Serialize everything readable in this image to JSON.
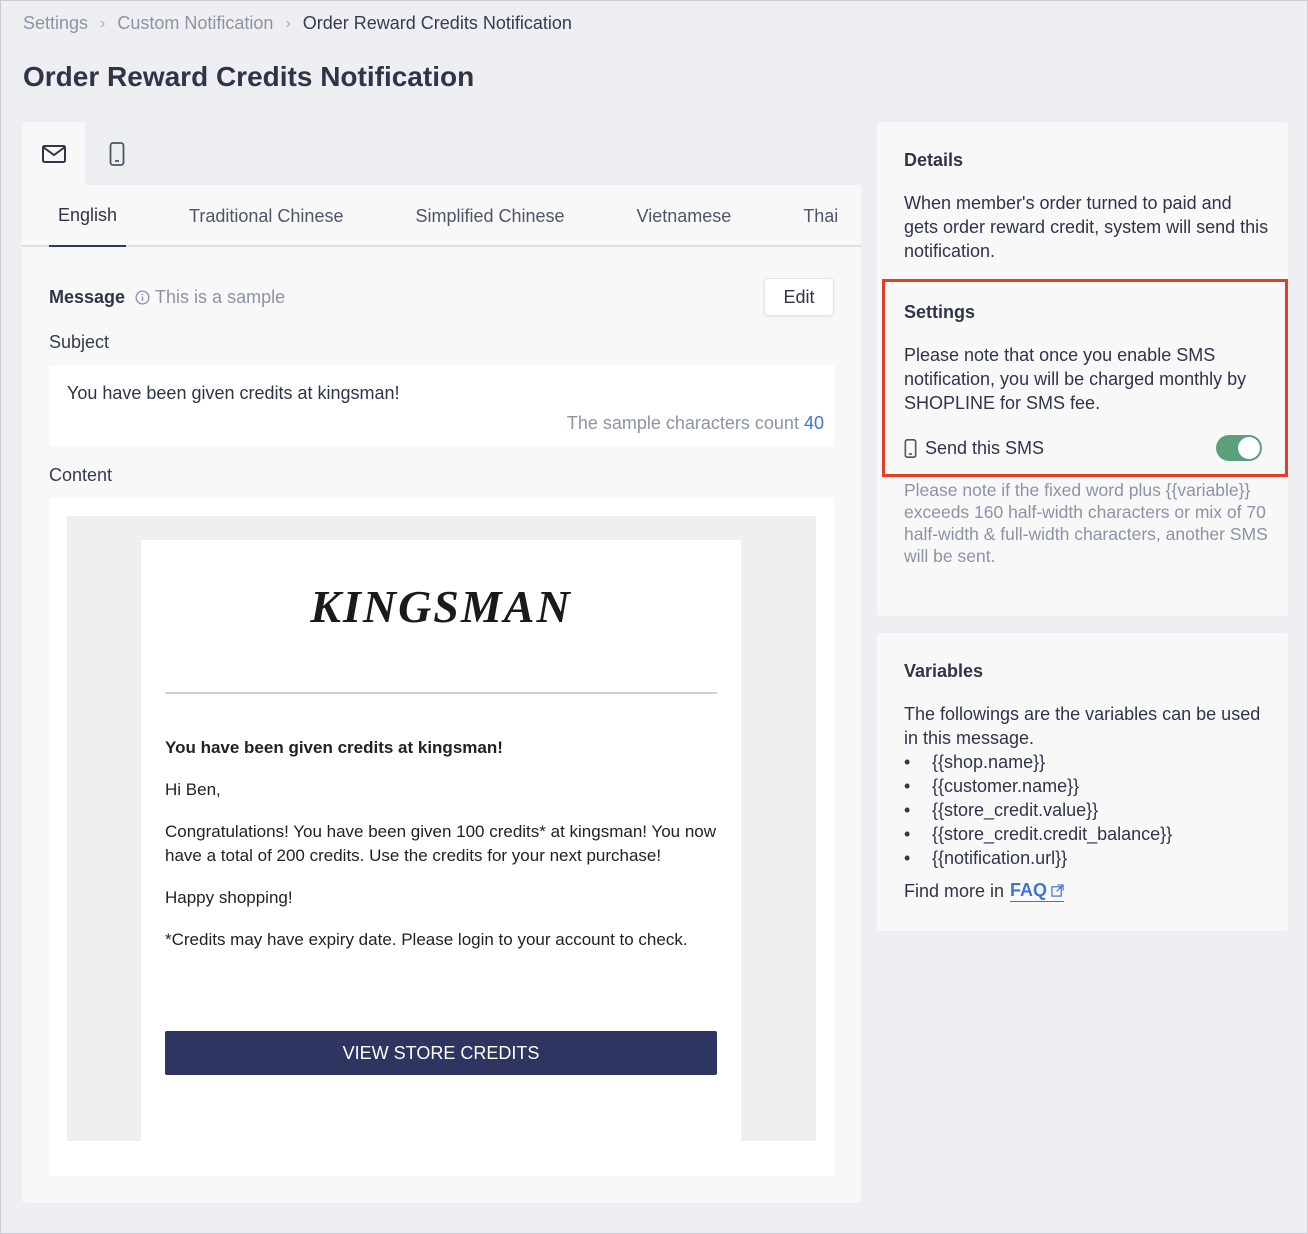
{
  "breadcrumb": {
    "items": [
      "Settings",
      "Custom Notification",
      "Order Reward Credits Notification"
    ]
  },
  "page_title": "Order Reward Credits Notification",
  "channels": {
    "tabs": [
      {
        "icon": "mail-icon",
        "active": true
      },
      {
        "icon": "mobile-icon",
        "active": false
      }
    ]
  },
  "languages": [
    "English",
    "Traditional Chinese",
    "Simplified Chinese",
    "Vietnamese",
    "Thai"
  ],
  "active_language": "English",
  "message": {
    "label": "Message",
    "sample_note": "This is a sample",
    "edit_label": "Edit",
    "subject_label": "Subject",
    "subject_text": "You have been given credits at kingsman!",
    "char_count_label": "The sample characters count",
    "char_count": "40",
    "content_label": "Content"
  },
  "email": {
    "logo": "KINGSMAN",
    "headline": "You have been given credits at kingsman!",
    "greeting": "Hi Ben,",
    "body": "Congratulations! You have been given 100 credits* at kingsman! You now have a total of 200 credits. Use the credits for your next purchase!",
    "closing": "Happy shopping!",
    "footnote": "*Credits may have expiry date. Please login to your account to check.",
    "cta": "VIEW STORE CREDITS"
  },
  "details": {
    "title": "Details",
    "text": "When member's order turned to paid and gets order reward credit, system will send this notification."
  },
  "settings": {
    "title": "Settings",
    "text": "Please note that once you enable SMS notification, you will be charged monthly by SHOPLINE for SMS fee.",
    "sms_label": "Send this SMS",
    "sms_enabled": true,
    "note": "Please note if the fixed word plus {{variable}} exceeds 160 half-width characters or mix of 70 half-width & full-width characters, another SMS will be sent."
  },
  "variables": {
    "title": "Variables",
    "text": "The followings are the variables can be used in this message.",
    "items": [
      "{{shop.name}}",
      "{{customer.name}}",
      "{{store_credit.value}}",
      "{{store_credit.credit_balance}}",
      "{{notification.url}}"
    ],
    "find_more": "Find more in",
    "faq": "FAQ"
  },
  "colors": {
    "accent": "#3f73d9",
    "toggle_on": "#5aa07a",
    "highlight_border": "#e14026",
    "cta_bg": "#2e3560"
  }
}
